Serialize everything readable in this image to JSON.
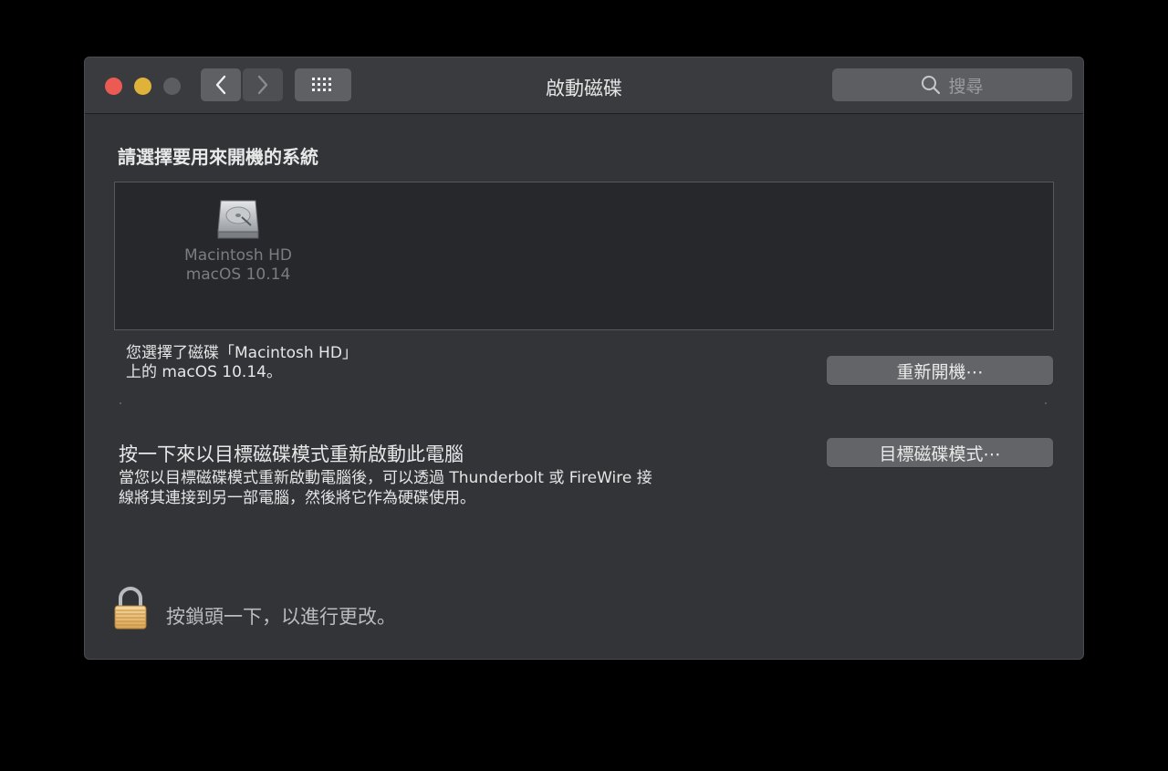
{
  "window": {
    "title": "啟動磁碟",
    "search_placeholder": "搜尋"
  },
  "main": {
    "heading": "請選擇要用來開機的系統",
    "disks": [
      {
        "name": "Macintosh HD",
        "os": "macOS 10.14",
        "icon": "hard-drive-icon"
      }
    ],
    "status_line1": "您選擇了磁碟「Macintosh HD」",
    "status_line2": "上的 macOS 10.14。",
    "restart_label": "重新開機⋯",
    "tdm_title": "按一下來以目標磁碟模式重新啟動此電腦",
    "tdm_desc_line1": "當您以目標磁碟模式重新啟動電腦後，可以透過 Thunderbolt 或 FireWire 接",
    "tdm_desc_line2": "線將其連接到另一部電腦，然後將它作為硬碟使用。",
    "tdm_button_label": "目標磁碟模式⋯",
    "lock_text": "按鎖頭一下，以進行更改。"
  },
  "colors": {
    "close": "#ec5a54",
    "minimize": "#dfb33a",
    "zoom_disabled": "#5b5d61",
    "window_bg": "#323438",
    "list_bg": "#26282b"
  }
}
